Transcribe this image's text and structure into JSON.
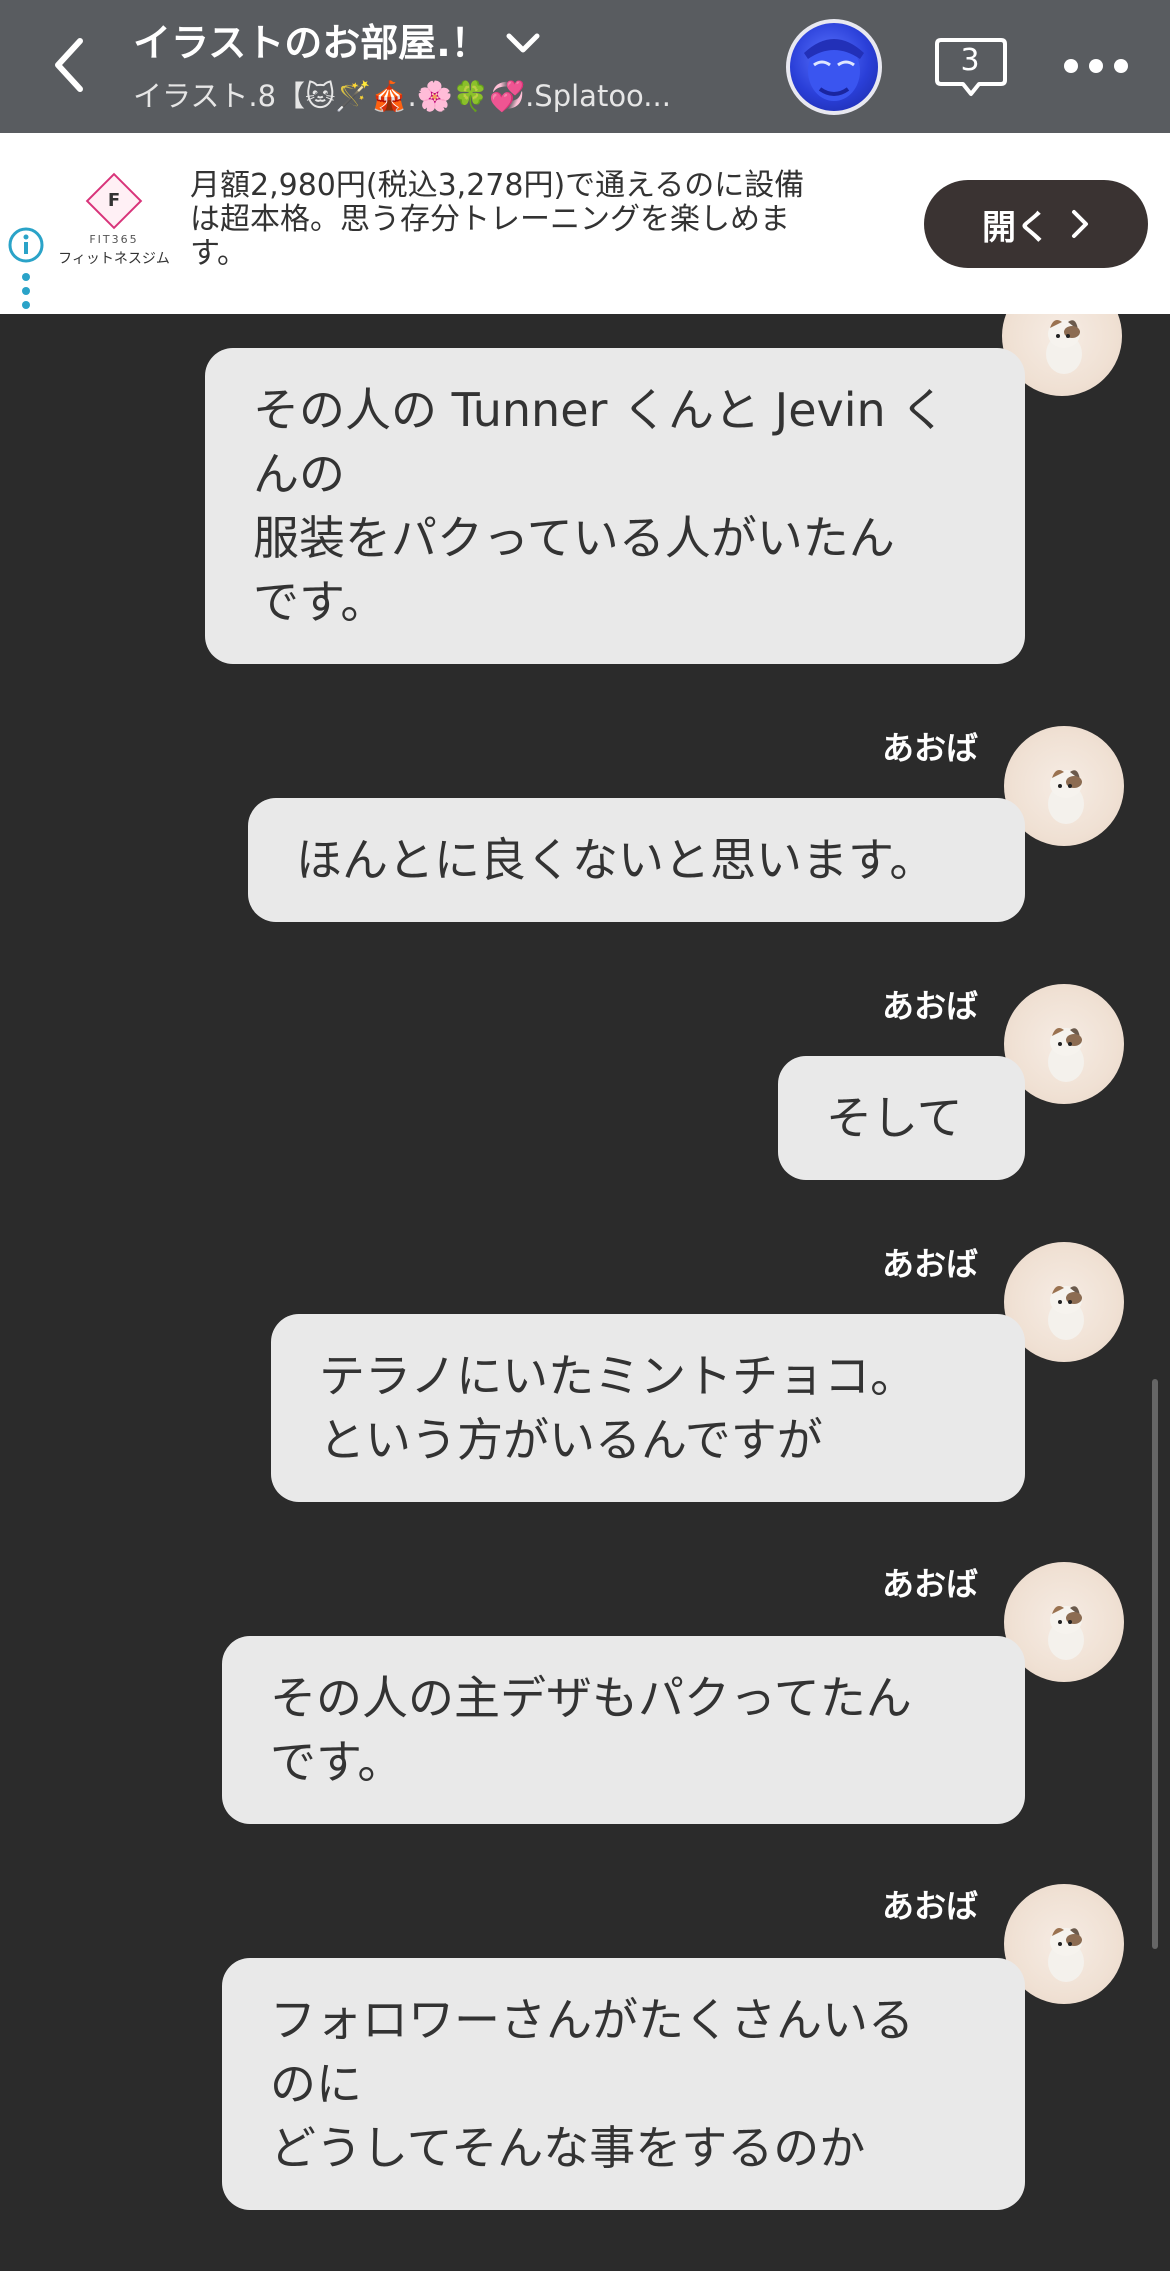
{
  "header": {
    "title": "イラストのお部屋.！",
    "subtitle": "イラスト.8【🐱🪄🎪.🌸🍀💞.Splatoo...",
    "notification_count": "3"
  },
  "ad": {
    "brand_small": "FIT365",
    "brand_name": "フィットネスジム",
    "text_lines": [
      "月額2,980円(税込3,278円)で通えるのに設備",
      "は超本格。思う存分トレーニングを楽しめま",
      "す。"
    ],
    "open_label": "開く"
  },
  "messages": [
    {
      "sender": "",
      "lines": [
        "その人の Tunner くんと Jevin く",
        "んの",
        "服装をパクっている人がいたん",
        "です。"
      ]
    },
    {
      "sender": "あおば",
      "lines": [
        "ほんとに良くないと思います。"
      ]
    },
    {
      "sender": "あおば",
      "lines": [
        "そして"
      ]
    },
    {
      "sender": "あおば",
      "lines": [
        "テラノにいたミントチョコ。",
        "という方がいるんですが"
      ]
    },
    {
      "sender": "あおば",
      "lines": [
        "その人の主デザもパクってたん",
        "です。"
      ]
    },
    {
      "sender": "あおば",
      "lines": [
        "フォロワーさんがたくさんいる",
        "のに",
        "どうしてそんな事をするのか"
      ]
    }
  ],
  "colors": {
    "header_bg": "#595c60",
    "chat_bg": "#2b2b2b",
    "bubble_bg": "#e9e9e9",
    "ad_button_bg": "#3a3332"
  },
  "icons": [
    "back-arrow-icon",
    "chevron-down-icon",
    "chat-bubble-icon",
    "more-icon",
    "info-icon",
    "chevron-right-icon"
  ]
}
